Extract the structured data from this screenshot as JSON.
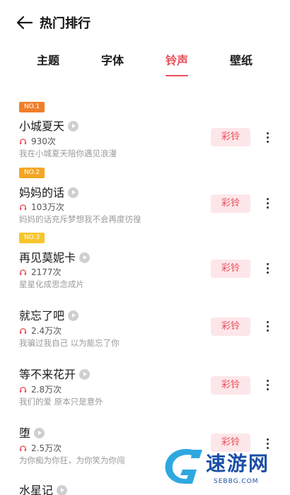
{
  "header": {
    "title": "热门排行",
    "back_icon": "arrow-left-icon"
  },
  "tabs": [
    {
      "label": "主题",
      "active": false
    },
    {
      "label": "字体",
      "active": false
    },
    {
      "label": "铃声",
      "active": true
    },
    {
      "label": "壁纸",
      "active": false
    }
  ],
  "colors": {
    "accent": "#e8505b",
    "button_bg": "#fde6e9",
    "badge1": "#f07f2a",
    "badge2": "#f5a623",
    "badge3": "#f8c52b"
  },
  "list": {
    "button_label": "彩铃",
    "items": [
      {
        "badge": "NO.1",
        "title": "小城夏天",
        "plays": "930次",
        "desc": "我在小城夏天陪你遇见浪漫"
      },
      {
        "badge": "NO.2",
        "title": "妈妈的话",
        "plays": "103万次",
        "desc": "妈妈的话充斥梦想我不会再度彷徨"
      },
      {
        "badge": "NO.3",
        "title": "再见莫妮卡",
        "plays": "2177次",
        "desc": "星星化成思念成片"
      },
      {
        "badge": "",
        "title": "就忘了吧",
        "plays": "2.4万次",
        "desc": "我骗过我自己 以为能忘了你"
      },
      {
        "badge": "",
        "title": "等不来花开",
        "plays": "2.8万次",
        "desc": "我们的爱 原本只是意外"
      },
      {
        "badge": "",
        "title": "堕",
        "plays": "2.5万次",
        "desc": "为你痴为你狂，为你笑为你闯"
      },
      {
        "badge": "",
        "title": "水星记",
        "plays": "",
        "desc": ""
      }
    ]
  },
  "watermark": {
    "text": "速游网",
    "url": "SEBBG.COM"
  }
}
